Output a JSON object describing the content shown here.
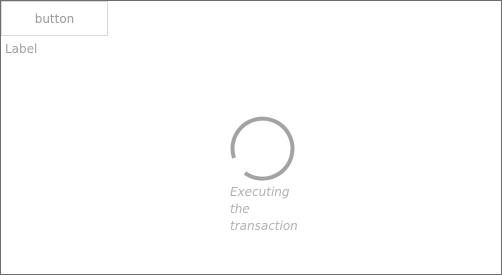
{
  "toolbar": {
    "button_label": "button"
  },
  "form": {
    "label_text": "Label"
  },
  "loader": {
    "status_text": "Executing\nthe\ntransaction",
    "spinner_color": "#a3a3a3"
  }
}
